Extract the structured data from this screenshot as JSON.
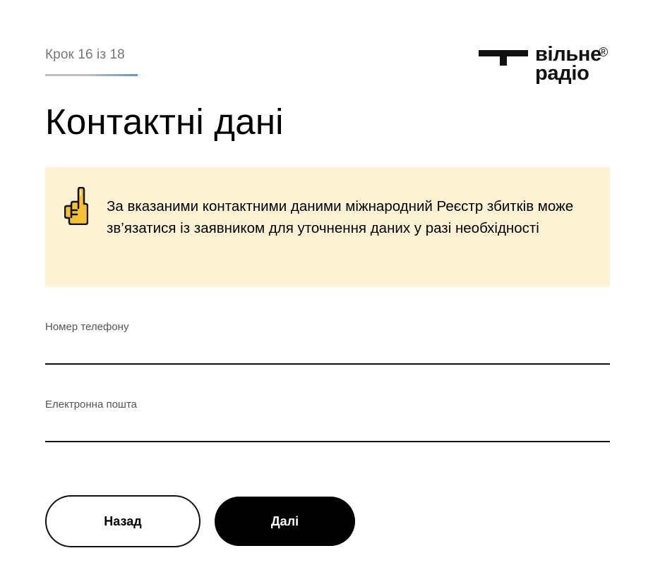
{
  "header": {
    "step_text": "Крок 16 із 18",
    "logo": {
      "line1": "вільне",
      "line2": "радіо",
      "registered": "®"
    }
  },
  "main": {
    "title": "Контактні дані",
    "notice": {
      "icon": "pointing-finger-icon",
      "text": "За вказаними контактними даними міжнародний Реєстр збитків може зв’язатися із заявником для уточнення даних у разі необхідності",
      "background": "#fdf2d3"
    },
    "fields": [
      {
        "label": "Номер телефону",
        "value": "",
        "placeholder": ""
      },
      {
        "label": "Електронна пошта",
        "value": "",
        "placeholder": ""
      }
    ],
    "buttons": {
      "back": "Назад",
      "next": "Далі"
    }
  },
  "colors": {
    "accent": "#5f94d2",
    "primary_button": "#000000",
    "notice_bg": "#fdf2d3"
  }
}
